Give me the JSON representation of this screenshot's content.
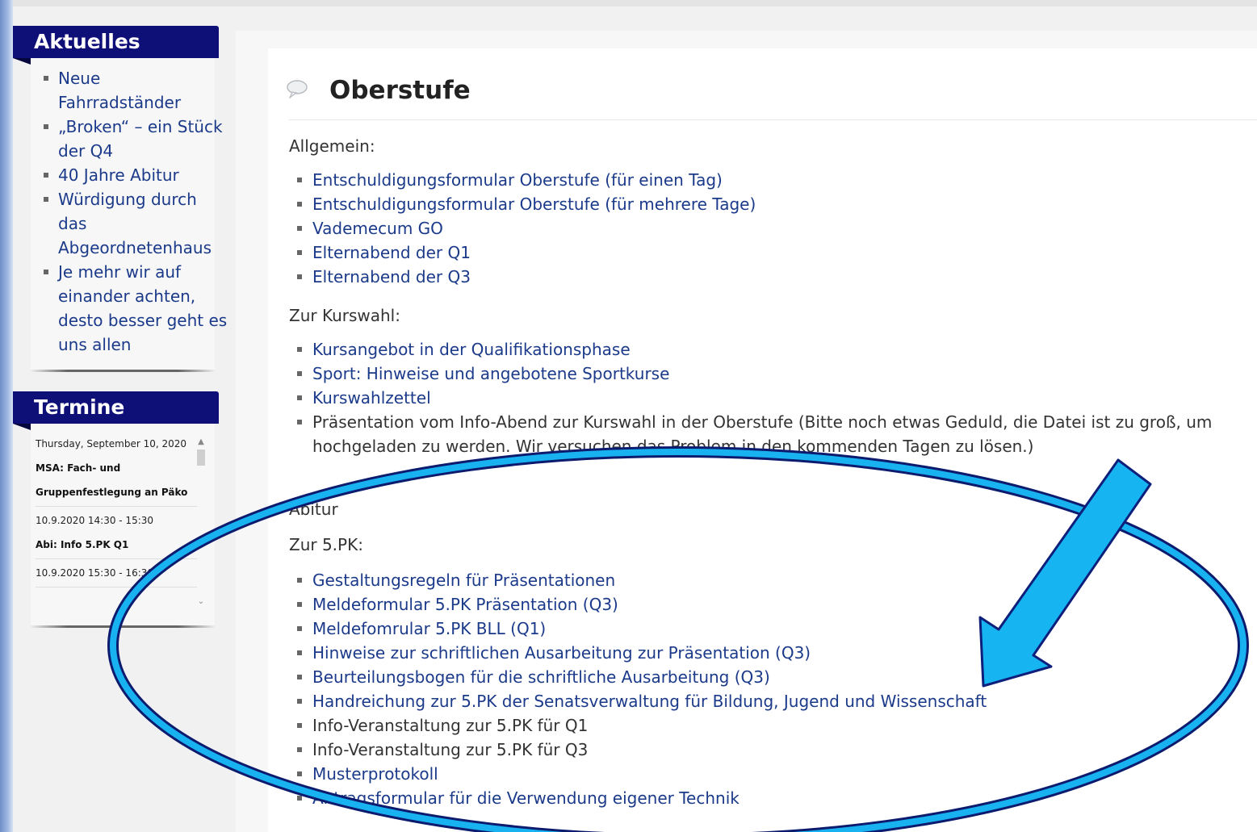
{
  "sidebar": {
    "news": {
      "title": "Aktuelles",
      "items": [
        "Neue Fahrradständer",
        "„Broken“ – ein Stück der Q4",
        "40 Jahre Abitur",
        "Würdigung durch das Abgeordnetenhaus",
        "Je mehr wir auf einander achten, desto besser geht es uns allen"
      ]
    },
    "events": {
      "title": "Termine",
      "items": [
        {
          "date": "Thursday, September 10, 2020",
          "title": "MSA: Fach- und Gruppenfestlegung an Päko"
        },
        {
          "date": "10.9.2020 14:30 - 15:30",
          "title": "Abi: Info 5.PK Q1"
        },
        {
          "date": "10.9.2020 15:30 - 16:30",
          "title": ""
        }
      ],
      "scroll_up": "▲",
      "scroll_down": "⌄"
    }
  },
  "main": {
    "title": "Oberstufe",
    "sections": [
      {
        "label": "Allgemein:",
        "links": [
          {
            "text": "Entschuldigungsformular Oberstufe (für einen Tag)",
            "link": true
          },
          {
            "text": "Entschuldigungsformular Oberstufe (für mehrere Tage)",
            "link": true
          },
          {
            "text": "Vademecum GO",
            "link": true
          },
          {
            "text": "Elternabend der Q1",
            "link": true
          },
          {
            "text": "Elternabend der Q3",
            "link": true
          }
        ]
      },
      {
        "label": "Zur Kurswahl:",
        "links": [
          {
            "text": "Kursangebot in der Qualifikationsphase",
            "link": true
          },
          {
            "text": "Sport: Hinweise und angebotene Sportkurse",
            "link": true
          },
          {
            "text": "Kurswahlzettel",
            "link": true
          },
          {
            "text": "Präsentation vom Info-Abend zur Kurswahl in der Oberstufe (Bitte noch etwas Geduld, die Datei ist zu groß, um hochgeladen zu werden. Wir versuchen das Problem in den kommenden Tagen zu lösen.)",
            "link": false
          }
        ]
      },
      {
        "label": "Abitur",
        "links": []
      },
      {
        "label": "Zur 5.PK:",
        "links": [
          {
            "text": "Gestaltungsregeln für Präsentationen",
            "link": true
          },
          {
            "text": "Meldeformular 5.PK Präsentation (Q3)",
            "link": true
          },
          {
            "text": "Meldefomrular 5.PK BLL (Q1)",
            "link": true
          },
          {
            "text": "Hinweise zur schriftlichen Ausarbeitung zur Präsentation (Q3)",
            "link": true
          },
          {
            "text": "Beurteilungsbogen für die schriftliche Ausarbeitung (Q3)",
            "link": true
          },
          {
            "text": "Handreichung zur 5.PK der Senatsverwaltung für Bildung, Jugend und Wissenschaft",
            "link": true
          },
          {
            "text": "Info-Veranstaltung zur 5.PK für Q1",
            "link": false
          },
          {
            "text": "Info-Veranstaltung zur 5.PK für Q3",
            "link": false
          },
          {
            "text": "Musterprotokoll",
            "link": true
          },
          {
            "text": "Antragsformular für die Verwendung eigener Technik",
            "link": true
          }
        ]
      }
    ]
  },
  "colors": {
    "sidebar_header": "#0f0f78",
    "link": "#1b3a8a",
    "annotation_ring": "#0c1b6e",
    "annotation_arrow": "#17b4f2"
  }
}
